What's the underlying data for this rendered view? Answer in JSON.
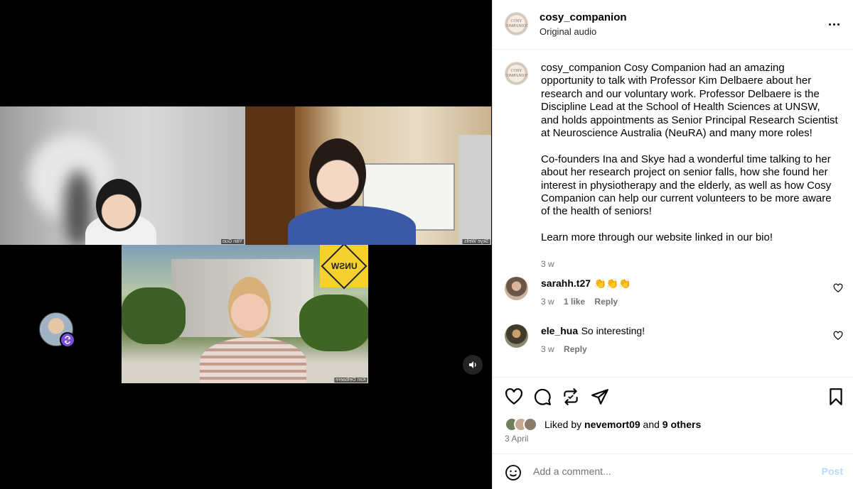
{
  "media": {
    "participants": [
      "Yilin Guo",
      "Skye Wells",
      "Kim Delbaere"
    ],
    "logo_text": "UNSW",
    "icons": {
      "remix": "remix-icon",
      "sound": "speaker-icon"
    }
  },
  "post": {
    "username": "cosy_companion",
    "audio": "Original audio",
    "avatar_text": "COSY COMPANION"
  },
  "caption": {
    "username": "cosy_companion",
    "paragraphs": [
      "Cosy Companion had an amazing opportunity to talk with Professor Kim Delbaere about her research and our voluntary work. Professor Delbaere is the Discipline Lead at the School of Health Sciences at UNSW, and holds appointments as Senior Principal Research Scientist at Neuroscience Australia (NeuRA) and many more roles!",
      "Co-founders Ina and Skye had a wonderful time talking to her about her research project on senior falls, how she found her interest in physiotherapy and the elderly, as well as how Cosy Companion can help our current volunteers to be more aware of the health of seniors!",
      "Learn more through our website linked in our bio!"
    ],
    "time": "3 w"
  },
  "comments": [
    {
      "username": "sarahh.t27",
      "text": "👏👏👏",
      "time": "3 w",
      "likes": "1 like",
      "reply": "Reply"
    },
    {
      "username": "ele_hua",
      "text": "So interesting!",
      "time": "3 w",
      "likes": "",
      "reply": "Reply"
    }
  ],
  "likes": {
    "prefix": "Liked by",
    "user": "nevemort09",
    "joiner": "and",
    "others": "9 others"
  },
  "date": "3 April",
  "comment_box": {
    "placeholder": "Add a comment...",
    "post_label": "Post"
  },
  "colors": {
    "accent": "#0095f6",
    "post_disabled": "#b3dbff",
    "muted": "#737373"
  }
}
